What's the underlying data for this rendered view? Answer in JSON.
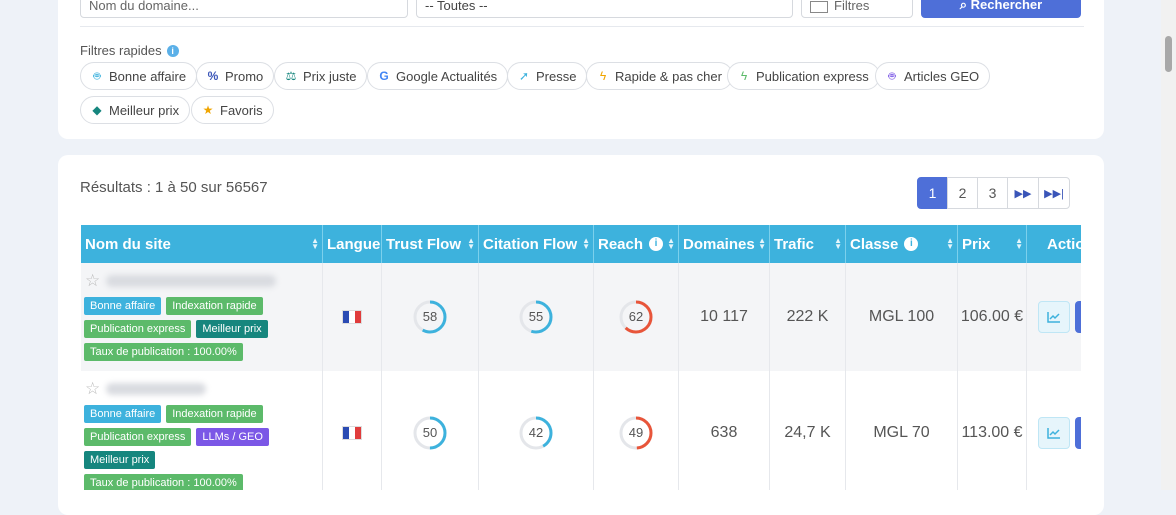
{
  "search": {
    "domain_placeholder": "Nom du domaine...",
    "lang_value": "-- Toutes --",
    "filters_label": "Filtres",
    "submit_label": "Rechercher"
  },
  "quick_filters": {
    "title": "Filtres rapides",
    "items": [
      {
        "label": "Bonne affaire",
        "icon": "robot-icon",
        "color": "#3db2dd"
      },
      {
        "label": "Promo",
        "icon": "percent-icon",
        "color": "#3a55b8"
      },
      {
        "label": "Prix juste",
        "icon": "scale-icon",
        "color": "#16867e"
      },
      {
        "label": "Google Actualités",
        "icon": "google-icon",
        "color": "#4285f4"
      },
      {
        "label": "Presse",
        "icon": "rocket-icon",
        "color": "#3db2dd"
      },
      {
        "label": "Rapide & pas cher",
        "icon": "bolt-icon",
        "color": "#f0a500"
      },
      {
        "label": "Publication express",
        "icon": "bolt-icon",
        "color": "#5cba6a"
      },
      {
        "label": "Articles GEO",
        "icon": "robot-icon",
        "color": "#7b57e6"
      },
      {
        "label": "Meilleur prix",
        "icon": "tag-icon",
        "color": "#16867e"
      },
      {
        "label": "Favoris",
        "icon": "star-icon",
        "color": "#f0a500"
      }
    ]
  },
  "results": {
    "summary": "Résultats : 1 à 50 sur 56567",
    "pages": [
      "1",
      "2",
      "3"
    ],
    "active_page": "1"
  },
  "table": {
    "columns": [
      "Nom du site",
      "Langue",
      "Trust Flow",
      "Citation Flow",
      "Reach",
      "Domaines",
      "Trafic",
      "Classe",
      "Prix",
      "Actio"
    ],
    "rows": [
      {
        "tags": [
          {
            "label": "Bonne affaire",
            "color": "cyan"
          },
          {
            "label": "Indexation rapide",
            "color": "green"
          },
          {
            "label": "Publication express",
            "color": "green"
          },
          {
            "label": "Meilleur prix",
            "color": "teal"
          },
          {
            "label": "Taux de publication : 100.00%",
            "color": "green"
          }
        ],
        "language": "fr",
        "trust_flow": 58,
        "citation_flow": 55,
        "reach": 62,
        "domaines": "10 117",
        "trafic": "222 K",
        "classe": "MGL 100",
        "prix": "106.00 €"
      },
      {
        "tags": [
          {
            "label": "Bonne affaire",
            "color": "cyan"
          },
          {
            "label": "Indexation rapide",
            "color": "green"
          },
          {
            "label": "Publication express",
            "color": "green"
          },
          {
            "label": "LLMs / GEO",
            "color": "purple"
          },
          {
            "label": "Meilleur prix",
            "color": "teal"
          },
          {
            "label": "Taux de publication : 100.00%",
            "color": "green"
          }
        ],
        "language": "fr",
        "trust_flow": 50,
        "citation_flow": 42,
        "reach": 49,
        "domaines": "638",
        "trafic": "24,7 K",
        "classe": "MGL 70",
        "prix": "113.00 €"
      }
    ]
  },
  "colors": {
    "accent": "#4e6fd8",
    "table_header": "#3db2dd",
    "ring_blue": "#3db2dd",
    "ring_red": "#e8553a"
  }
}
